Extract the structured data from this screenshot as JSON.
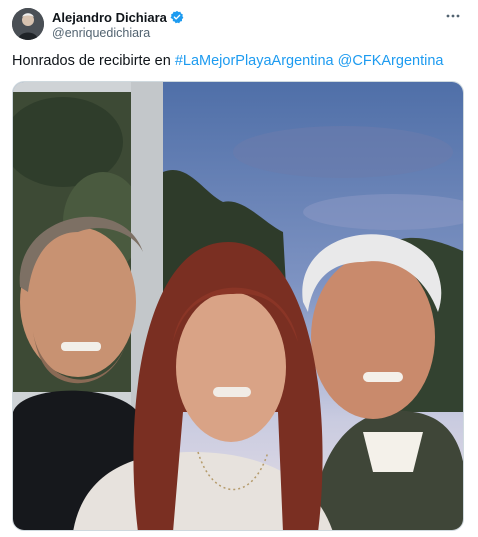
{
  "author": {
    "display_name": "Alejandro Dichiara",
    "handle": "@enriquedichiara",
    "verified": true
  },
  "tweet": {
    "text_prefix": "Honrados de recibirte en ",
    "hashtag": "#LaMejorPlayaArgentina",
    "separator": " ",
    "mention": "@CFKArgentina"
  },
  "icons": {
    "verified": "verified-badge-icon",
    "more": "more-dots-icon"
  },
  "colors": {
    "link": "#1d9bf0",
    "verified": "#1d9bf0",
    "text": "#0f1419",
    "muted": "#536471"
  }
}
